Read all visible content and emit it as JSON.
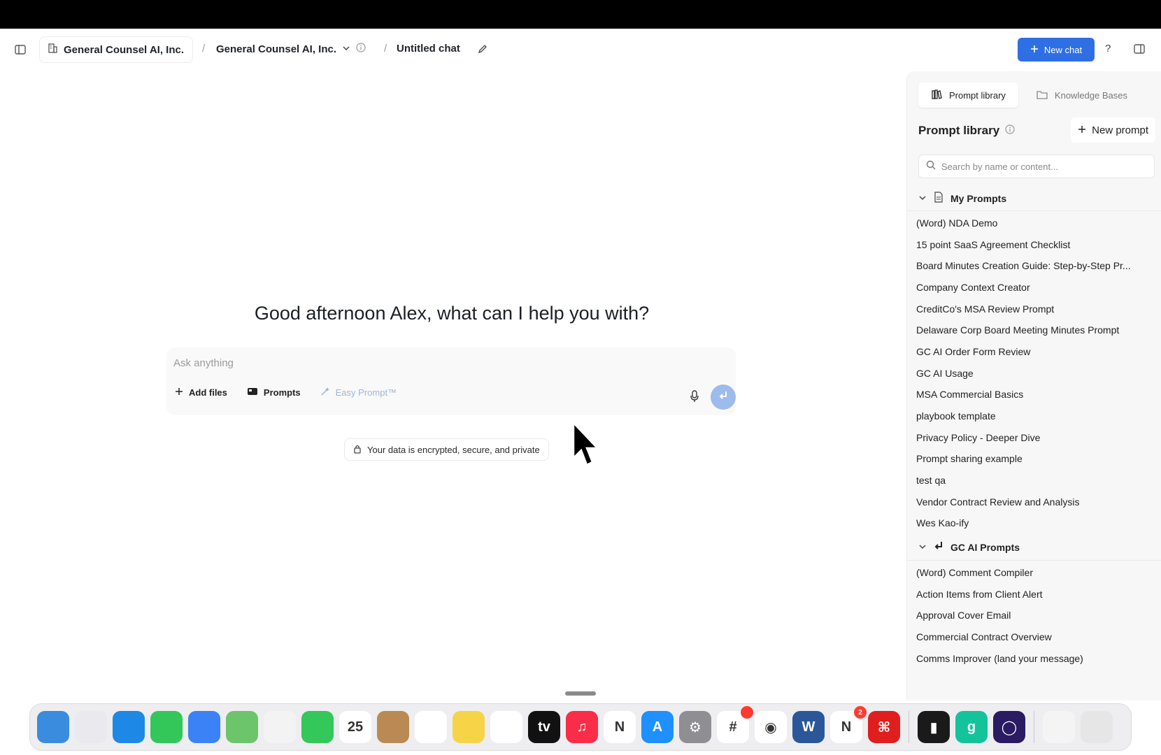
{
  "header": {
    "org": "General Counsel AI, Inc.",
    "workspace": "General Counsel AI, Inc.",
    "chat_title": "Untitled chat",
    "separator": "/",
    "new_chat_label": "New chat",
    "help_label": "?"
  },
  "main": {
    "greeting": "Good afternoon Alex, what can I help you with?",
    "input_placeholder": "Ask anything",
    "add_files": "Add files",
    "prompts": "Prompts",
    "easy_prompt": "Easy Prompt™",
    "secure_note": "Your data is encrypted, secure, and private"
  },
  "sidebar": {
    "tabs": [
      {
        "label": "Prompt library",
        "active": true
      },
      {
        "label": "Knowledge Bases",
        "active": false
      }
    ],
    "title": "Prompt library",
    "new_prompt": "New prompt",
    "search_placeholder": "Search by name or content...",
    "sections": [
      {
        "title": "My Prompts",
        "items": [
          "(Word) NDA Demo",
          "15 point SaaS Agreement Checklist",
          "Board Minutes Creation Guide: Step-by-Step Pr...",
          "Company Context Creator",
          "CreditCo's MSA Review Prompt",
          "Delaware Corp Board Meeting Minutes Prompt",
          "GC AI Order Form Review",
          "GC AI Usage",
          "MSA Commercial Basics",
          "playbook template",
          "Privacy Policy - Deeper Dive",
          "Prompt sharing example",
          "test qa",
          "Vendor Contract Review and Analysis",
          "Wes Kao-ify"
        ]
      },
      {
        "title": "GC AI Prompts",
        "items": [
          "(Word) Comment Compiler",
          "Action Items from Client Alert",
          "Approval Cover Email",
          "Commercial Contract Overview",
          "Comms Improver (land your message)"
        ]
      }
    ]
  },
  "dock": {
    "apps": [
      {
        "name": "finder-icon",
        "color": "#3a8dde",
        "glyph": ""
      },
      {
        "name": "launchpad-icon",
        "color": "#e9e9ee",
        "glyph": ""
      },
      {
        "name": "safari-icon",
        "color": "#1e88e5",
        "glyph": ""
      },
      {
        "name": "messages-icon",
        "color": "#33c759",
        "glyph": ""
      },
      {
        "name": "mail-icon",
        "color": "#3b82f6",
        "glyph": ""
      },
      {
        "name": "maps-icon",
        "color": "#6cc56a",
        "glyph": ""
      },
      {
        "name": "photos-icon",
        "color": "#f3f3f3",
        "glyph": ""
      },
      {
        "name": "facetime-icon",
        "color": "#34c759",
        "glyph": ""
      },
      {
        "name": "calendar-icon",
        "color": "#ffffff",
        "glyph": "25"
      },
      {
        "name": "contacts-icon",
        "color": "#b98a53",
        "glyph": ""
      },
      {
        "name": "reminders-icon",
        "color": "#ffffff",
        "glyph": ""
      },
      {
        "name": "notes-icon",
        "color": "#f5d547",
        "glyph": ""
      },
      {
        "name": "freeform-icon",
        "color": "#ffffff",
        "glyph": ""
      },
      {
        "name": "appletv-icon",
        "color": "#111111",
        "glyph": "tv"
      },
      {
        "name": "music-icon",
        "color": "#fa2d48",
        "glyph": "♫"
      },
      {
        "name": "news-icon",
        "color": "#ffffff",
        "glyph": "N"
      },
      {
        "name": "appstore-icon",
        "color": "#1e90ff",
        "glyph": "A"
      },
      {
        "name": "settings-icon",
        "color": "#8e8e93",
        "glyph": "⚙"
      },
      {
        "name": "slack-icon",
        "color": "#ffffff",
        "glyph": "#",
        "badge": " "
      },
      {
        "name": "chrome-icon",
        "color": "#ffffff",
        "glyph": "◉"
      },
      {
        "name": "word-icon",
        "color": "#2b579a",
        "glyph": "W"
      },
      {
        "name": "notion-icon",
        "color": "#ffffff",
        "glyph": "N",
        "badge": "2"
      },
      {
        "name": "acrobat-icon",
        "color": "#e01e1e",
        "glyph": "⌘"
      },
      {
        "name": "audio-icon",
        "color": "#1a1a1a",
        "glyph": "▮"
      },
      {
        "name": "grammarly-icon",
        "color": "#15c39a",
        "glyph": "g"
      },
      {
        "name": "ring-app-icon",
        "color": "#2a1b63",
        "glyph": "◯"
      },
      {
        "name": "document-icon",
        "color": "#f4f4f4",
        "glyph": ""
      },
      {
        "name": "trash-icon",
        "color": "#e6e6e6",
        "glyph": ""
      }
    ]
  }
}
